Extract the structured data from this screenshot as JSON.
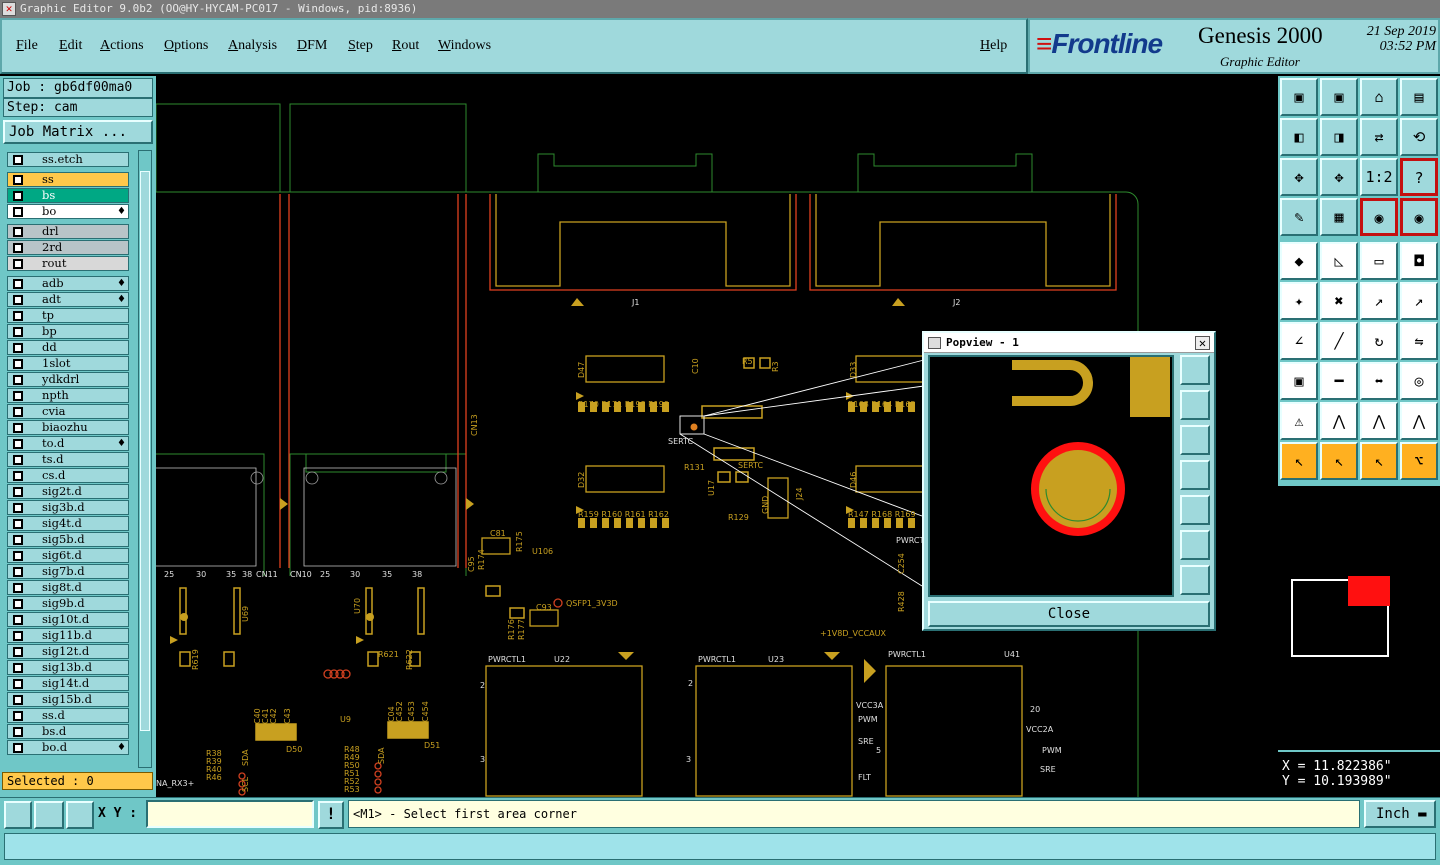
{
  "window": {
    "title": "Graphic Editor 9.0b2 (OO@HY-HYCAM-PC017 - Windows, pid:8936)"
  },
  "menu": {
    "items": [
      "File",
      "Edit",
      "Actions",
      "Options",
      "Analysis",
      "DFM",
      "Step",
      "Rout",
      "Windows"
    ],
    "help": "Help"
  },
  "brand": {
    "logo": "Frontline",
    "product": "Genesis 2000",
    "subtitle": "Graphic Editor",
    "date": "21 Sep 2019",
    "time": "03:52 PM"
  },
  "job": {
    "job_label": "Job : gb6df00ma0",
    "step_label": "Step: cam",
    "matrix_button": "Job Matrix ..."
  },
  "layers": [
    {
      "name": "ss.etch",
      "color": "#9fd9dc"
    },
    {
      "name": "ss",
      "color": "#ffc84a"
    },
    {
      "name": "bs",
      "color": "#00a884"
    },
    {
      "name": "bo",
      "color": "#ffffff",
      "icon": "flame"
    },
    {
      "name": "drl",
      "color": "#b8c4c8"
    },
    {
      "name": "2rd",
      "color": "#b8c4c8"
    },
    {
      "name": "rout",
      "color": "#d8d8d8"
    },
    {
      "name": "adb",
      "color": "#9fd9dc",
      "icon": "flame"
    },
    {
      "name": "adt",
      "color": "#9fd9dc",
      "icon": "flame"
    },
    {
      "name": "tp",
      "color": "#9fd9dc"
    },
    {
      "name": "bp",
      "color": "#9fd9dc"
    },
    {
      "name": "dd",
      "color": "#9fd9dc"
    },
    {
      "name": "1slot",
      "color": "#9fd9dc"
    },
    {
      "name": "ydkdrl",
      "color": "#9fd9dc"
    },
    {
      "name": "npth",
      "color": "#9fd9dc"
    },
    {
      "name": "cvia",
      "color": "#9fd9dc"
    },
    {
      "name": "biaozhu",
      "color": "#9fd9dc"
    },
    {
      "name": "to.d",
      "color": "#9fd9dc",
      "icon": "flame"
    },
    {
      "name": "ts.d",
      "color": "#9fd9dc"
    },
    {
      "name": "cs.d",
      "color": "#9fd9dc"
    },
    {
      "name": "sig2t.d",
      "color": "#9fd9dc"
    },
    {
      "name": "sig3b.d",
      "color": "#9fd9dc"
    },
    {
      "name": "sig4t.d",
      "color": "#9fd9dc"
    },
    {
      "name": "sig5b.d",
      "color": "#9fd9dc"
    },
    {
      "name": "sig6t.d",
      "color": "#9fd9dc"
    },
    {
      "name": "sig7b.d",
      "color": "#9fd9dc"
    },
    {
      "name": "sig8t.d",
      "color": "#9fd9dc"
    },
    {
      "name": "sig9b.d",
      "color": "#9fd9dc"
    },
    {
      "name": "sig10t.d",
      "color": "#9fd9dc"
    },
    {
      "name": "sig11b.d",
      "color": "#9fd9dc"
    },
    {
      "name": "sig12t.d",
      "color": "#9fd9dc"
    },
    {
      "name": "sig13b.d",
      "color": "#9fd9dc"
    },
    {
      "name": "sig14t.d",
      "color": "#9fd9dc"
    },
    {
      "name": "sig15b.d",
      "color": "#9fd9dc"
    },
    {
      "name": "ss.d",
      "color": "#9fd9dc"
    },
    {
      "name": "bs.d",
      "color": "#9fd9dc"
    },
    {
      "name": "bo.d",
      "color": "#9fd9dc",
      "icon": "flame"
    }
  ],
  "selected": "Selected : 0",
  "popview": {
    "title": "Popview - 1",
    "close": "Close"
  },
  "board_labels": {
    "j1": "J1",
    "j2": "J2",
    "cn13": "CN13",
    "cn11": "CN11",
    "cn10": "CN10",
    "d47": "D47",
    "d32": "D32",
    "d33": "D33",
    "d46": "D46",
    "r5": "R5",
    "r3": "R3",
    "c10": "C10",
    "r170": "R170 R171 R198 R199",
    "r163": "R163 R164 R165",
    "r159": "R159 R160 R161 R162",
    "r147": "R147 R168 R169",
    "sertc": "SERTC",
    "sertc2": "SERTC",
    "r131": "R131",
    "r129": "R129",
    "u17": "U17",
    "j24": "J24",
    "gnd": "GND",
    "c81": "C81",
    "u106": "U106",
    "c93": "C93",
    "qsfp": "QSFP1_3V3D",
    "r175": "R175",
    "c95": "C95",
    "r174": "R174",
    "r176": "R176",
    "r177": "R177",
    "u69": "U69",
    "r619": "R619",
    "r621": "R621",
    "r622": "R622",
    "u70": "U70",
    "u9": "U9",
    "d50": "D50",
    "d51": "D51",
    "pwr1": "PWRCTL1",
    "pwr2": "PWRCTL1",
    "pwr3": "PWRCTL1",
    "pwr4": "PWRCTL",
    "u22": "U22",
    "u23": "U23",
    "u41": "U41",
    "vccaux": "+1V8D_VCCAUX",
    "vcc3a": "VCC3A",
    "pwm": "PWM",
    "sre": "SRE",
    "flt": "FLT",
    "vcc2a": "VCC2A",
    "pwm2": "PWM",
    "sre2": "SRE",
    "n20": "20",
    "n5": "5",
    "n2a": "2",
    "n3a": "3",
    "n2b": "2",
    "n3b": "3",
    "t25a": "25",
    "t30a": "30",
    "t35a": "35",
    "t38a": "38",
    "t25b": "25",
    "t30b": "30",
    "t35b": "35",
    "t38b": "38",
    "rx3": "NA_RX3+",
    "r38": "R38",
    "r39": "R39",
    "r40": "R40",
    "r46": "R46",
    "r48": "R48",
    "r49": "R49",
    "r50": "R50",
    "r51": "R51",
    "r52": "R52",
    "r53": "R53",
    "r428": "R428",
    "c254": "C254",
    "c40": "C40",
    "c41": "C41",
    "c42": "C42",
    "c43": "C43",
    "c452": "C452",
    "c453": "C453",
    "c454": "C454",
    "c04": "C04",
    "sda": "SDA",
    "sda2": "SDA",
    "scl": "SCL"
  },
  "coords": {
    "x": "X = 11.822386\"",
    "y": "Y = 10.193989\""
  },
  "status": {
    "xy_label": "X Y :",
    "xy_value": "",
    "message": "<M1> - Select first area corner",
    "units": "Inch"
  },
  "colors": {
    "panel": "#6fc7c7",
    "button": "#9fd9dc",
    "outline": "#2e8a2e",
    "pad": "#c8a020",
    "drill_red": "#ff1010"
  }
}
